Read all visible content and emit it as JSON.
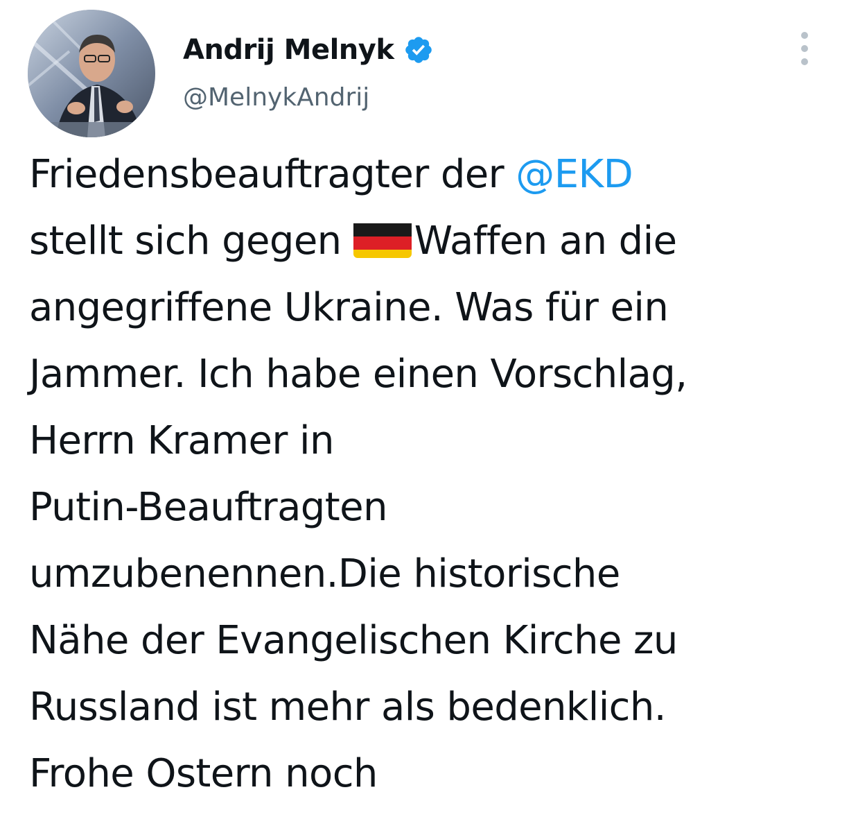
{
  "tweet": {
    "display_name": "Andrij Melnyk",
    "handle": "@MelnykAndrij",
    "verified": true,
    "avatar_icon": "profile-photo",
    "more_icon": "more-options-icon",
    "mention_color": "#1d9bf0",
    "text_lines": [
      {
        "before": "Friedensbeauftragter der ",
        "mention": "@EKD",
        "after": ""
      },
      {
        "before": "stellt sich gegen ",
        "flag": "germany-flag-icon",
        "after": "Waffen an die"
      },
      {
        "text": "angegriffene Ukraine. Was für ein"
      },
      {
        "text": "Jammer. Ich habe einen Vorschlag,"
      },
      {
        "text": "Herrn Kramer in"
      },
      {
        "text": "Putin-Beauftragten"
      },
      {
        "text": "umzubenennen.Die historische"
      },
      {
        "text": "Nähe der Evangelischen Kirche zu"
      },
      {
        "text": "Russland ist mehr als bedenklich."
      },
      {
        "text": "Frohe Ostern noch"
      }
    ]
  }
}
